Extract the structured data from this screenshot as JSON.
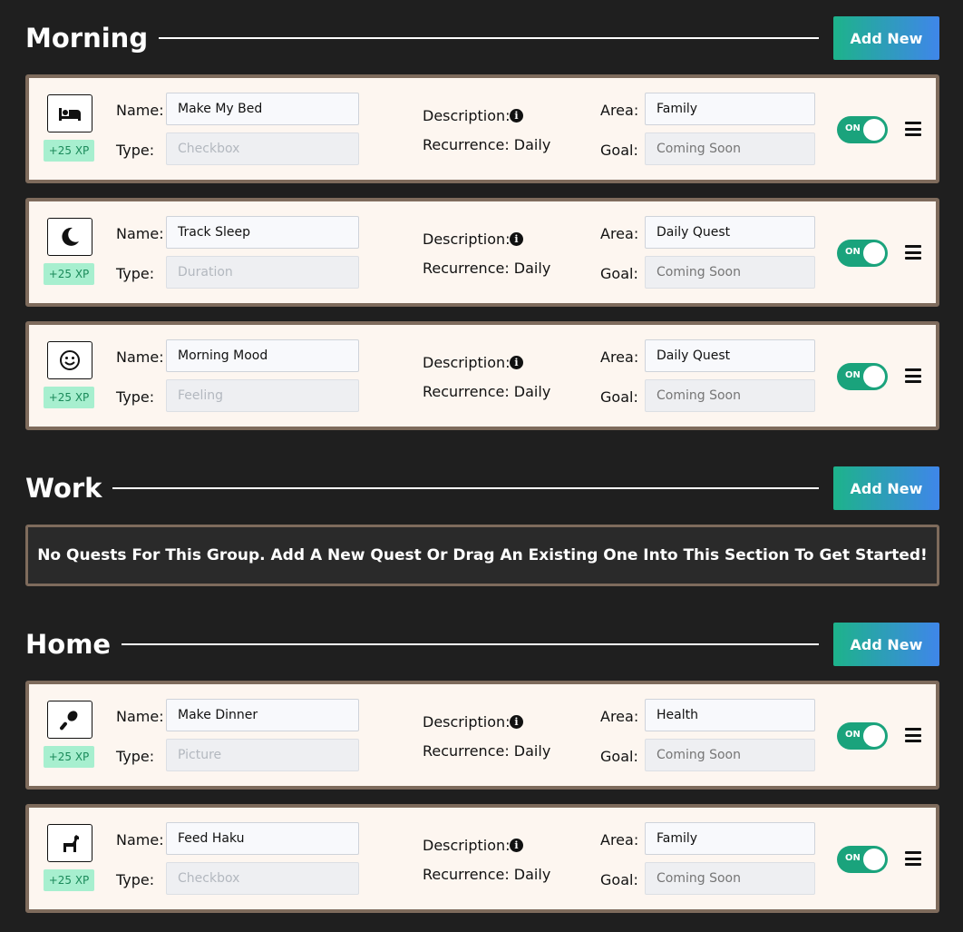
{
  "colors": {
    "accent_green": "#1db38a",
    "accent_blue": "#3f86ea",
    "card_border": "#7e6b5c",
    "background": "#1f1f1f"
  },
  "labels": {
    "name": "Name:",
    "type": "Type:",
    "description": "Description:",
    "recurrence": "Recurrence: Daily",
    "area": "Area:",
    "goal": "Goal:",
    "goal_placeholder": "Coming Soon",
    "toggle_on": "ON",
    "add_new": "Add New"
  },
  "sections": [
    {
      "title": "Morning",
      "quests": [
        {
          "icon": "bed-icon",
          "xp": "+25 XP",
          "name": "Make My Bed",
          "type": "Checkbox",
          "area": "Family"
        },
        {
          "icon": "moon-icon",
          "xp": "+25 XP",
          "name": "Track Sleep",
          "type": "Duration",
          "area": "Daily Quest"
        },
        {
          "icon": "smiley-icon",
          "xp": "+25 XP",
          "name": "Morning Mood",
          "type": "Feeling",
          "area": "Daily Quest"
        }
      ]
    },
    {
      "title": "Work",
      "empty_message": "No Quests For This Group. Add A New Quest Or Drag An Existing One Into This Section To Get Started!",
      "quests": []
    },
    {
      "title": "Home",
      "quests": [
        {
          "icon": "spoon-icon",
          "xp": "+25 XP",
          "name": "Make Dinner",
          "type": "Picture",
          "area": "Health"
        },
        {
          "icon": "dog-icon",
          "xp": "+25 XP",
          "name": "Feed Haku",
          "type": "Checkbox",
          "area": "Family"
        }
      ]
    }
  ]
}
